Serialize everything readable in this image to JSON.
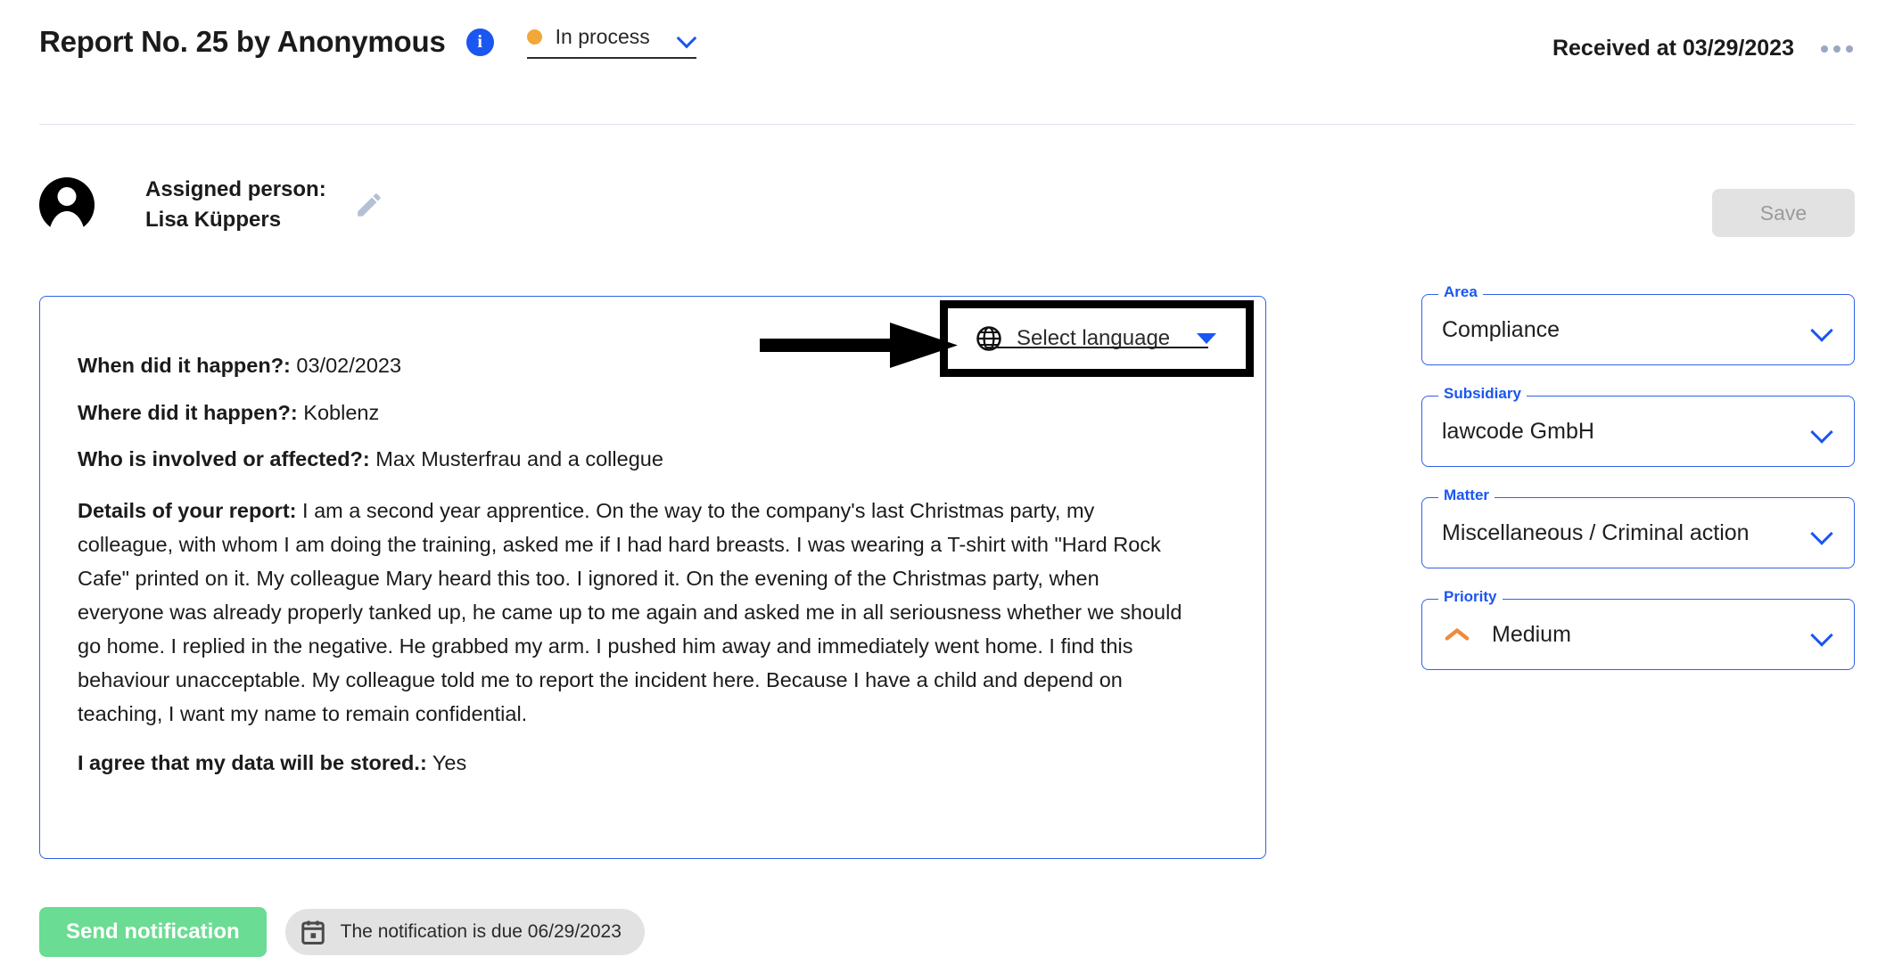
{
  "header": {
    "title": "Report No. 25 by Anonymous",
    "info_icon": "info-icon",
    "status": {
      "label": "In process",
      "dot_color": "#f2a73b"
    },
    "received": "Received at 03/29/2023",
    "more_menu": "ellipsis-icon"
  },
  "assigned": {
    "label": "Assigned person:",
    "name": "Lisa Küppers",
    "edit_icon": "pencil-icon",
    "save_label": "Save"
  },
  "language_selector": {
    "label": "Select language",
    "icon": "globe-icon",
    "caret": "triangle-down-icon",
    "highlighted": true
  },
  "report": {
    "when_q": "When did it happen?:",
    "when_a": " 03/02/2023",
    "where_q": "Where did it happen?:",
    "where_a": " Koblenz",
    "who_q": "Who is involved or affected?:",
    "who_a": " Max Musterfrau and a collegue",
    "details_q": "Details of your report:",
    "details_a": " I am a second year apprentice. On the way to the company's last Christmas party, my colleague, with whom I am doing the training, asked me if I had hard breasts. I was wearing a T-shirt with \"Hard Rock Cafe\" printed on it. My colleague Mary heard this too. I ignored it. On the evening of the Christmas party, when everyone was already properly tanked up, he came up to me again and asked me in all seriousness whether we should go home. I replied in the negative. He grabbed my arm. I pushed him away and immediately went home. I find this behaviour unacceptable. My colleague told me to report the incident here. Because I have a child and depend on teaching, I want my name to remain confidential.",
    "consent_q": "I agree that my data will be stored.:",
    "consent_a": " Yes"
  },
  "side_panel": {
    "fields": [
      {
        "label": "Area",
        "value": "Compliance",
        "icon": null
      },
      {
        "label": "Subsidiary",
        "value": "lawcode GmbH",
        "icon": null
      },
      {
        "label": "Matter",
        "value": "Miscellaneous / Criminal action",
        "icon": null
      },
      {
        "label": "Priority",
        "value": "Medium",
        "icon": "priority-medium-chevron-icon"
      }
    ]
  },
  "footer": {
    "send_label": "Send notification",
    "due_icon": "calendar-icon",
    "due_label": "The notification is due 06/29/2023"
  },
  "colors": {
    "accent_blue": "#1a56f0",
    "border_blue": "#2f62e8",
    "status_orange": "#f2a73b",
    "priority_orange": "#ee8b3c",
    "send_green": "#6bdc93",
    "disabled_gray": "#e2e2e2"
  }
}
